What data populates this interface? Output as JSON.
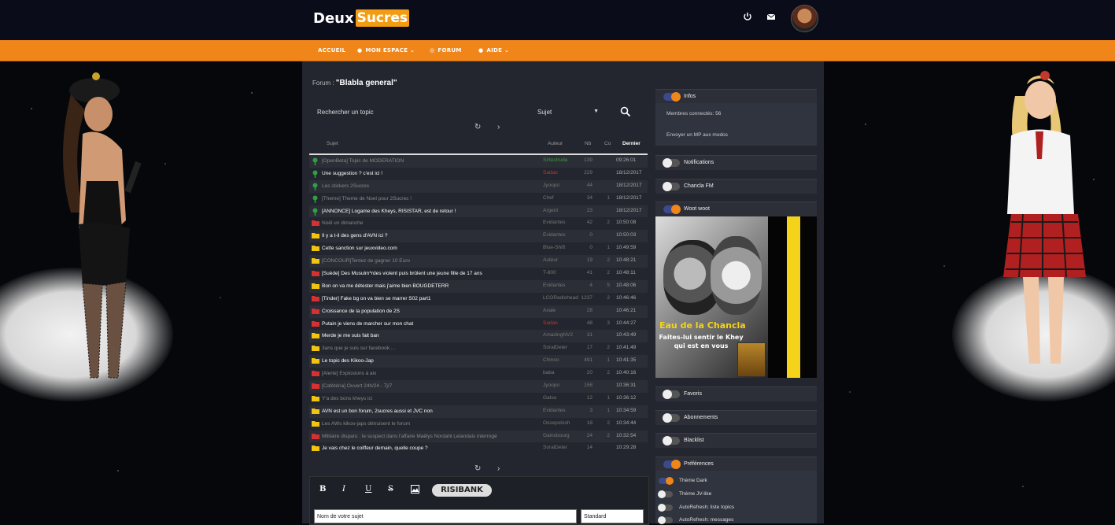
{
  "header": {
    "logo_part1": "Deux",
    "logo_part2": "Sucres",
    "icons": [
      "power-icon",
      "mail-icon"
    ]
  },
  "nav": {
    "accueil": "ACCUEIL",
    "mon_espace": "MON ESPACE",
    "forum": "FORUM",
    "aide": "AIDE"
  },
  "breadcrumb": {
    "prefix": "Forum :",
    "title": "\"Blabla general\""
  },
  "search": {
    "placeholder": "Rechercher un topic",
    "select_value": "Sujet"
  },
  "table": {
    "headers": {
      "sujet": "Sujet",
      "auteur": "Auteur",
      "nb": "Nb",
      "co": "Co",
      "dernier": "Dernier"
    },
    "rows": [
      {
        "icon": "pin",
        "title": "[OpenBeta] Topic de MODERATION",
        "author": "Sirtectrude",
        "author_color": "green",
        "nb": "139",
        "co": "",
        "last": "09:26:01",
        "bright": false
      },
      {
        "icon": "pin",
        "title": "Une suggestion ? c'est ici !",
        "author": "Sadan",
        "author_color": "red",
        "nb": "229",
        "co": "",
        "last": "18/12/2017",
        "bright": true
      },
      {
        "icon": "pin",
        "title": "Les stickers 2Sucres",
        "author": "Jyoopo",
        "author_color": "normal",
        "nb": "44",
        "co": "",
        "last": "18/12/2017",
        "bright": false
      },
      {
        "icon": "pin",
        "title": "[Theme] Theme de Noel pour 2Sucres !",
        "author": "Chef",
        "author_color": "normal",
        "nb": "34",
        "co": "1",
        "last": "18/12/2017",
        "bright": false
      },
      {
        "icon": "pin",
        "title": "[ANNONCE] Logame des Kheys, RISISTAR, est de retour !",
        "author": "Argent",
        "author_color": "normal",
        "nb": "23",
        "co": "",
        "last": "18/12/2017",
        "bright": true
      },
      {
        "icon": "red",
        "title": "Noël un dimanche",
        "author": "Evidantes",
        "author_color": "normal",
        "nb": "42",
        "co": "2",
        "last": "10:50:08",
        "bright": false
      },
      {
        "icon": "yellow",
        "title": "Il y a t-il des gens d'AVN ici ?",
        "author": "Evidantes",
        "author_color": "normal",
        "nb": "0",
        "co": "",
        "last": "10:50:03",
        "bright": true
      },
      {
        "icon": "yellow",
        "title": "Cette sanction sur jeuxvideo.com",
        "author": "Blue-Shift",
        "author_color": "normal",
        "nb": "0",
        "co": "1",
        "last": "10:49:59",
        "bright": true
      },
      {
        "icon": "yellow",
        "title": "[CONCOUR]Tentez de gagner 10 Euro",
        "author": "Auteur",
        "author_color": "normal",
        "nb": "19",
        "co": "2",
        "last": "10:48:21",
        "bright": false
      },
      {
        "icon": "red",
        "title": "[Suède] Des Musulm*rdes violent puis brûlent une jeune fille de 17 ans",
        "author": "T-800",
        "author_color": "normal",
        "nb": "41",
        "co": "2",
        "last": "10:48:11",
        "bright": true
      },
      {
        "icon": "yellow",
        "title": "Bon on va me détester mais j'aime bien BOUGDETERR",
        "author": "Evidantes",
        "author_color": "normal",
        "nb": "4",
        "co": "5",
        "last": "10:48:06",
        "bright": true
      },
      {
        "icon": "red",
        "title": "[Tinder] Fake bg on va bien se marrer S02 part1",
        "author": "LCORadiohead",
        "author_color": "normal",
        "nb": "1237",
        "co": "2",
        "last": "10:46:46",
        "bright": true
      },
      {
        "icon": "red",
        "title": "Croissance de la population de 2S",
        "author": "Axale",
        "author_color": "normal",
        "nb": "28",
        "co": "",
        "last": "10:46:21",
        "bright": true
      },
      {
        "icon": "red",
        "title": "Putain je viens de marcher sur mon chat",
        "author": "Sadan",
        "author_color": "red",
        "nb": "48",
        "co": "3",
        "last": "10:44:27",
        "bright": true
      },
      {
        "icon": "yellow",
        "title": "Merde je me suis fait ban",
        "author": "AmazingNV2",
        "author_color": "normal",
        "nb": "31",
        "co": "",
        "last": "10:43:49",
        "bright": true
      },
      {
        "icon": "yellow",
        "title": "3ans que je suis sur facebook ...",
        "author": "SoralDeter",
        "author_color": "normal",
        "nb": "17",
        "co": "2",
        "last": "10:41:49",
        "bright": false
      },
      {
        "icon": "yellow",
        "title": "Le topic des Kikoo-Jap",
        "author": "Chinoo",
        "author_color": "normal",
        "nb": "491",
        "co": "1",
        "last": "10:41:35",
        "bright": true
      },
      {
        "icon": "red",
        "title": "[Alerte] Explosions à aix",
        "author": "baba",
        "author_color": "normal",
        "nb": "20",
        "co": "2",
        "last": "10:40:16",
        "bright": false
      },
      {
        "icon": "red",
        "title": "[Cafétéria] Ouvert 24h/24 - 7j/7",
        "author": "Jyoopo",
        "author_color": "normal",
        "nb": "158",
        "co": "",
        "last": "10:36:31",
        "bright": false
      },
      {
        "icon": "yellow",
        "title": "Y'a des bons kheys ici",
        "author": "Gatsu",
        "author_color": "normal",
        "nb": "12",
        "co": "1",
        "last": "10:36:12",
        "bright": false
      },
      {
        "icon": "yellow",
        "title": "AVN est un bon forum, 2sucres aussi et JVC non",
        "author": "Evidantes",
        "author_color": "normal",
        "nb": "3",
        "co": "1",
        "last": "10:34:59",
        "bright": true
      },
      {
        "icon": "yellow",
        "title": "Les AWs kikoo-japs détruisent le forum",
        "author": "Ossepolosh",
        "author_color": "normal",
        "nb": "18",
        "co": "2",
        "last": "10:34:44",
        "bright": false
      },
      {
        "icon": "red",
        "title": "Militaire disparu : le suspect dans l'affaire Maëlys Nordahl Lelandais interrogé",
        "author": "Gainsbourg",
        "author_color": "normal",
        "nb": "24",
        "co": "2",
        "last": "10:32:54",
        "bright": false
      },
      {
        "icon": "yellow",
        "title": "Je vais chez le coiffeur demain, quelle coupe ?",
        "author": "SoralDeter",
        "author_color": "normal",
        "nb": "14",
        "co": "",
        "last": "10:29:28",
        "bright": true
      }
    ]
  },
  "editor": {
    "tools": [
      "B",
      "I",
      "U",
      "S",
      "img"
    ],
    "risibank": "RISIBANK",
    "subject_placeholder": "Nom de votre sujet",
    "type_value": "Standard"
  },
  "sidebar": {
    "infos_title": "Infos",
    "members_connected": "Membres connectés: 56",
    "send_mp": "Envoyer un MP aux modos",
    "notifications": "Notifications",
    "chancla_fm": "Chancla FM",
    "woot_woot": "Woot woot",
    "favoris": "Favoris",
    "abonnements": "Abonnements",
    "blacklist": "Blacklist",
    "preferences": "Préférences",
    "prefs": [
      {
        "label": "Thème Dark",
        "on": true
      },
      {
        "label": "Thème JV-like",
        "on": false
      },
      {
        "label": "AutoRefresh: liste topics",
        "on": false
      },
      {
        "label": "AutoRefresh: messages",
        "on": false
      }
    ]
  },
  "ad": {
    "title": "Eau de la Chancla",
    "line1": "Faites-lui sentir le Khey",
    "line2": "qui est en vous"
  },
  "colors": {
    "accent": "#f0861a",
    "header_bg": "#0a0c1a",
    "main_bg": "#23262e",
    "pin_green": "#2ea043",
    "folder_red": "#d63031",
    "folder_yellow": "#f1c40f"
  }
}
